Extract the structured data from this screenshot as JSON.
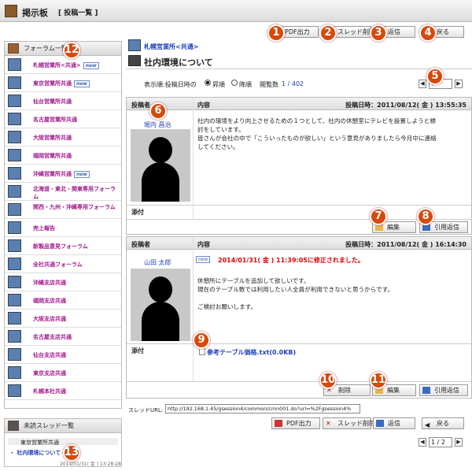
{
  "header": {
    "title": "掲示板",
    "subtitle": "[ 投稿一覧 ]"
  },
  "toolbar": {
    "pdf": "PDF出力",
    "thread_delete": "スレッド削除",
    "reply": "返信",
    "back": "戻る"
  },
  "sidebar": {
    "title": "フォーラム一覧",
    "items": [
      {
        "label": "札幌営業所<共通>",
        "new": "new"
      },
      {
        "label": "東京営業所共通",
        "new": "new"
      },
      {
        "label": "仙台営業所共通"
      },
      {
        "label": "名古屋営業所共通"
      },
      {
        "label": "大阪営業所共通"
      },
      {
        "label": "福岡営業所共通"
      },
      {
        "label": "沖縄営業所共通",
        "new": "new"
      },
      {
        "label": "北海道・東北・関東専用フォーラム"
      },
      {
        "label": "関西・九州・沖縄専用フォーラム"
      },
      {
        "label": "売上報告"
      },
      {
        "label": "新製品意見フォーラム"
      },
      {
        "label": "全社共通フォーラム"
      },
      {
        "label": "沖縄支店共通"
      },
      {
        "label": "福岡支店共通"
      },
      {
        "label": "大阪支店共通"
      },
      {
        "label": "名古屋支店共通"
      },
      {
        "label": "仙台支店共通"
      },
      {
        "label": "東京支店共通"
      },
      {
        "label": "札幌本社共通"
      }
    ]
  },
  "unread": {
    "title": "未読スレッド一覧",
    "forum": "東京営業所共通",
    "thread": "・ 社内環境について",
    "date": "2014/01/31( 金 ) 13:28:28"
  },
  "thread": {
    "breadcrumb": "札幌営業所<共通>",
    "title": "社内環境について",
    "order_label": "表示順:投稿日時の",
    "asc": "昇順",
    "desc": "降順",
    "views_label": "閲覧数",
    "views": "1 / 402"
  },
  "columns": {
    "author": "投稿者",
    "content": "内容",
    "attach": "添付"
  },
  "posts": [
    {
      "date": "投稿日時：2011/08/12( 金 ) 13:55:35",
      "author": "堀内 昌治",
      "body": [
        "社内の環境をより向上させるための１つとして、社内の休憩室にテレビを設置しようと検",
        "討をしています。",
        "皆さんが会社の中で「こういったものが欲しい」という意見がありましたら今月中に連絡",
        "してください。"
      ],
      "edit": "編集",
      "quote": "引用返信"
    },
    {
      "date": "投稿日時：2011/08/12( 金 ) 16:14:30",
      "author": "山田 太郎",
      "new": "new",
      "modified": "2014/01/31( 金 ) 11:39:05に修正されました。",
      "body": [
        "休憩所にテーブルを追加して欲しいです。",
        "現在のテーブル数では利用したい人全員が利用できないと思うからです。",
        "",
        "ご検討お願いします。"
      ],
      "attachment": "参考テーブル価格.txt(0.0KB)",
      "delete": "削除",
      "edit": "編集",
      "quote": "引用返信"
    }
  ],
  "thread_url": {
    "label": "スレッドURL:",
    "value": "http://192.168.1.45/gsession4/common/cmn001.do?url=%2Fgsession4%"
  },
  "pager": {
    "value": "1 / 2"
  },
  "markers": [
    "1",
    "2",
    "3",
    "4",
    "5",
    "6",
    "7",
    "8",
    "9",
    "10",
    "11",
    "12",
    "13"
  ],
  "colors": {
    "accent": "#d64a0c",
    "forum": "#a0198c",
    "link": "#1c3fb7",
    "modified": "#dd0000"
  }
}
